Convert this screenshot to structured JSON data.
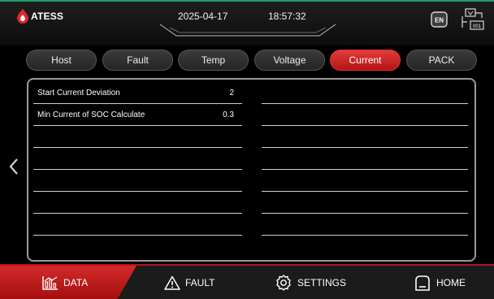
{
  "header": {
    "brand": "ATESS",
    "date": "2025-04-17",
    "time": "18:57:32",
    "lang": "EN",
    "device_tag": "001"
  },
  "tabs": [
    {
      "label": "Host",
      "active": false
    },
    {
      "label": "Fault",
      "active": false
    },
    {
      "label": "Temp",
      "active": false
    },
    {
      "label": "Voltage",
      "active": false
    },
    {
      "label": "Current",
      "active": true
    },
    {
      "label": "PACK",
      "active": false
    }
  ],
  "params": [
    {
      "label": "Start Current Deviation",
      "value": "2"
    },
    {
      "label": "Min Current of SOC Calculate",
      "value": "0.3"
    }
  ],
  "footer": {
    "data": "DATA",
    "fault": "FAULT",
    "settings": "SETTINGS",
    "home": "HOME"
  },
  "colors": {
    "accent": "#c81e1e",
    "status_line": "#1e9e6a"
  }
}
